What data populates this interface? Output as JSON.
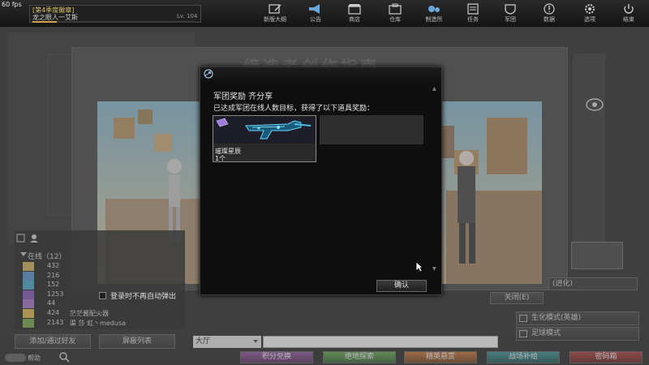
{
  "fps": "60 fps",
  "player": {
    "rank": "[第4季度徽章]",
    "name": "龙之眼人一艾斯",
    "level": "Lv. 104",
    "xp_fraction": 0.15
  },
  "nav": [
    {
      "label": "新版大纲",
      "icon": "edit-icon"
    },
    {
      "label": "公告",
      "icon": "megaphone-icon"
    },
    {
      "label": "商店",
      "icon": "shop-icon"
    },
    {
      "label": "仓库",
      "icon": "inventory-icon"
    },
    {
      "label": "制造所",
      "icon": "craft-icon"
    },
    {
      "label": "任务",
      "icon": "mission-icon"
    },
    {
      "label": "军团",
      "icon": "shield-icon"
    },
    {
      "label": "数据",
      "icon": "info-icon"
    },
    {
      "label": "选项",
      "icon": "gear-icon"
    },
    {
      "label": "结束",
      "icon": "power-icon"
    }
  ],
  "banner": {
    "title": "缔造者创作指南"
  },
  "friends": {
    "online_label": "在线（12）",
    "rows": [
      {
        "num": "432",
        "name": "",
        "badge_color": "#c8a84a"
      },
      {
        "num": "216",
        "name": "",
        "badge_color": "#4a8ac8"
      },
      {
        "num": "152",
        "name": "",
        "badge_color": "#3aa0c0"
      },
      {
        "num": "1253",
        "name": "",
        "badge_color": "#7a4ab0"
      },
      {
        "num": "44",
        "name": "",
        "badge_color": "#9a6ac0"
      },
      {
        "num": "424",
        "name": "茫茫酱配火器",
        "badge_color": "#d4b040"
      },
      {
        "num": "2143",
        "name": "渠 莎 虹丶medusa",
        "badge_color": "#6aa040"
      }
    ],
    "add_label": "添加/通过好友",
    "block_label": "屏蔽列表"
  },
  "help_label": "帮助",
  "chat": {
    "channel": "大厅",
    "input_value": ""
  },
  "tabs": {
    "points": "积分兑换",
    "explore": "绝地探索",
    "elite": "精英悬赏",
    "supply": "战场补给",
    "box": "密码箱"
  },
  "modes": {
    "evolve": "(进化)",
    "bio": "生化模式(英雄)",
    "football": "足球模式"
  },
  "close_label": "关闭(E)",
  "dont_popup_label": "登录时不再自动弹出",
  "dialog": {
    "title": "军团奖励  齐分享",
    "subtitle": "已达成军团在线人数目标，获得了以下道具奖励：",
    "reward_name": "璀璨星辰",
    "reward_qty": "1个",
    "confirm_label": "确认"
  }
}
